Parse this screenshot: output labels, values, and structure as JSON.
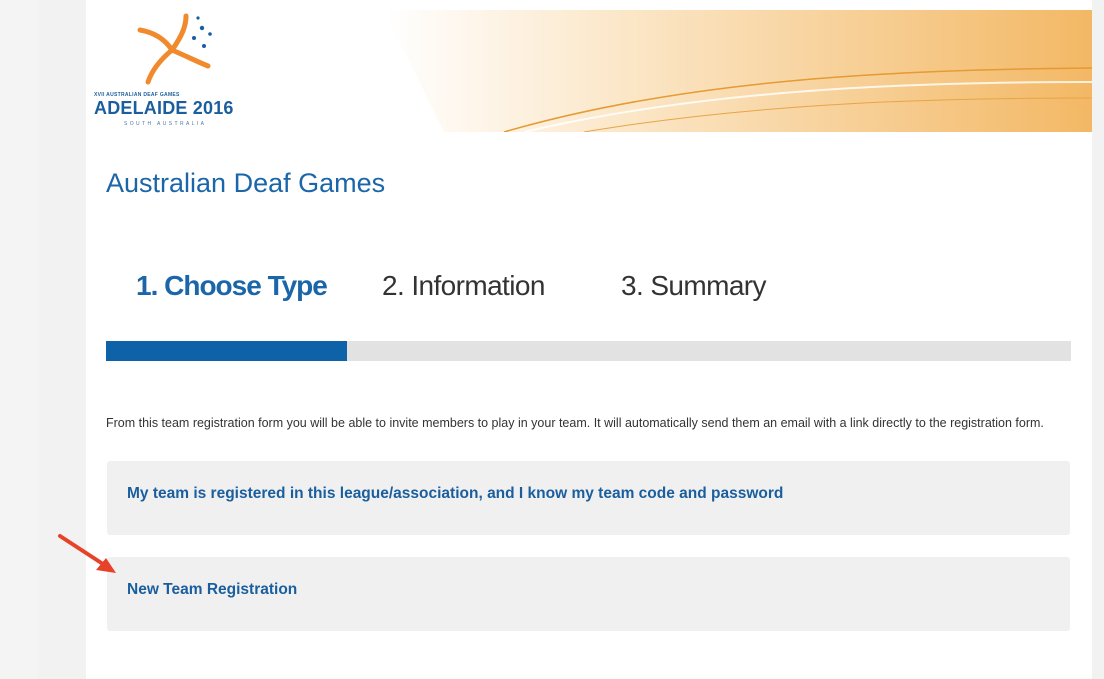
{
  "logo": {
    "small_text": "XVII AUSTRALIAN DEAF GAMES",
    "main_text": "ADELAIDE 2016",
    "sub_text": "SOUTH AUSTRALIA"
  },
  "page_title": "Australian Deaf Games",
  "steps": [
    {
      "label": "1. Choose Type",
      "active": true
    },
    {
      "label": "2. Information",
      "active": false
    },
    {
      "label": "3. Summary",
      "active": false
    }
  ],
  "progress": {
    "fraction": 0.25
  },
  "intro_text": "From this team registration form you will be able to invite members to play in your team. It will automatically send them an email with a link directly to the registration form.",
  "options": [
    {
      "label": "My team is registered in this league/association, and I know my team code and password"
    },
    {
      "label": "New Team Registration"
    }
  ],
  "colors": {
    "brand_blue": "#1a66a8",
    "progress_fill": "#0e63a8",
    "arrow": "#e8412a",
    "swoosh": "#f0b25a"
  }
}
